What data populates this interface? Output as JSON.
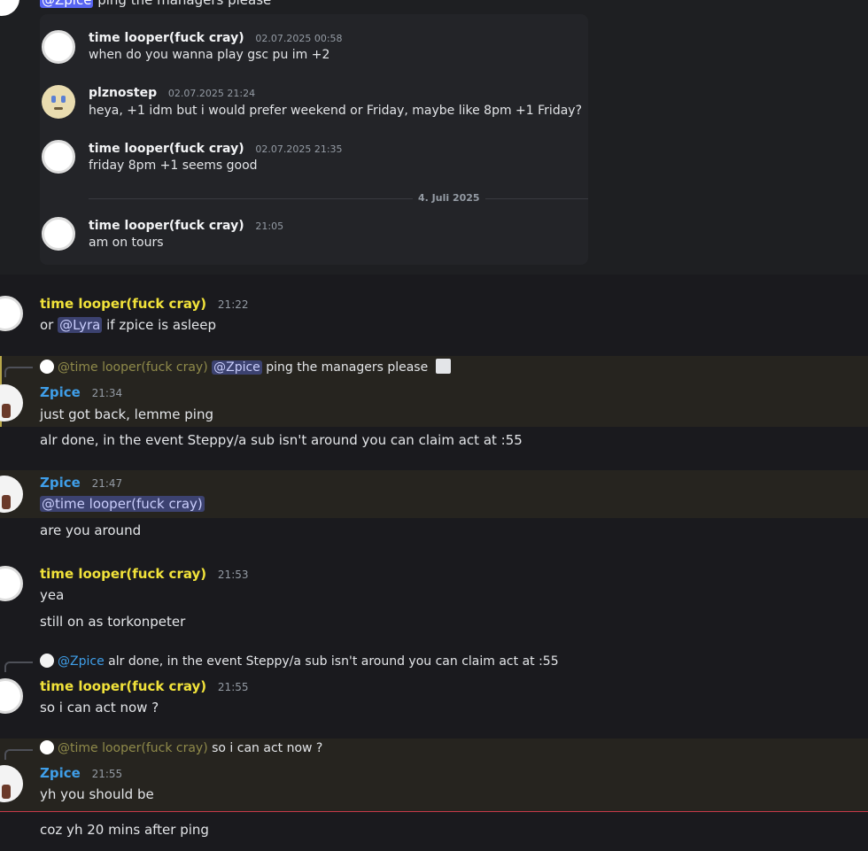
{
  "top_reply_text": "ping the managers please",
  "top_reply_mention": "@Zpice",
  "forwarded": {
    "messages": [
      {
        "author": "time looper(fuck cray)",
        "time": "02.07.2025 00:58",
        "text": "when do you wanna play gsc pu im +2",
        "avatar": "clock"
      },
      {
        "author": "plznostep",
        "time": "02.07.2025 21:24",
        "text": "heya, +1 idm but i would prefer weekend or Friday, maybe like 8pm +1 Friday?",
        "avatar": "face"
      },
      {
        "author": "time looper(fuck cray)",
        "time": "02.07.2025 21:35",
        "text": "friday 8pm +1 seems good",
        "avatar": "clock"
      },
      {
        "author": "time looper(fuck cray)",
        "time": "21:05",
        "text": "am on tours",
        "avatar": "clock"
      }
    ],
    "divider": "4. Juli 2025"
  },
  "msgs": {
    "m1": {
      "author": "time looper(fuck cray)",
      "time": "21:22",
      "pre": "or ",
      "mention": "@Lyra",
      "post": " if zpice is asleep"
    },
    "m2": {
      "reply_mention": "@time looper(fuck cray)",
      "reply_mention2": "@Zpice",
      "reply_text": "ping the managers please",
      "author": "Zpice",
      "time": "21:34",
      "text": "just got back, lemme ping",
      "text2": "alr done, in the event Steppy/a sub isn't around you can claim act at :55"
    },
    "m3": {
      "author": "Zpice",
      "time": "21:47",
      "mention": "@time looper(fuck cray)",
      "text": "are you around"
    },
    "m4": {
      "author": "time looper(fuck cray)",
      "time": "21:53",
      "text": "yea",
      "text2": "still on as torkonpeter"
    },
    "m5": {
      "reply_mention": "@Zpice",
      "reply_text": "alr done, in the event Steppy/a sub isn't around you can claim act at :55",
      "author": "time looper(fuck cray)",
      "time": "21:55",
      "text": "so i can act now ?"
    },
    "m6": {
      "reply_mention": "@time looper(fuck cray)",
      "reply_text": "so i can act now ?",
      "author": "Zpice",
      "time": "21:55",
      "text": "yh you should be",
      "text2": "coz yh 20 mins after ping"
    }
  },
  "colors": {
    "background": "#1a1a1e",
    "username_yellow": "#f1e23a",
    "username_blue": "#3f9ee8",
    "mention_bg": "#3c4270",
    "new_divider": "#c6394a"
  }
}
